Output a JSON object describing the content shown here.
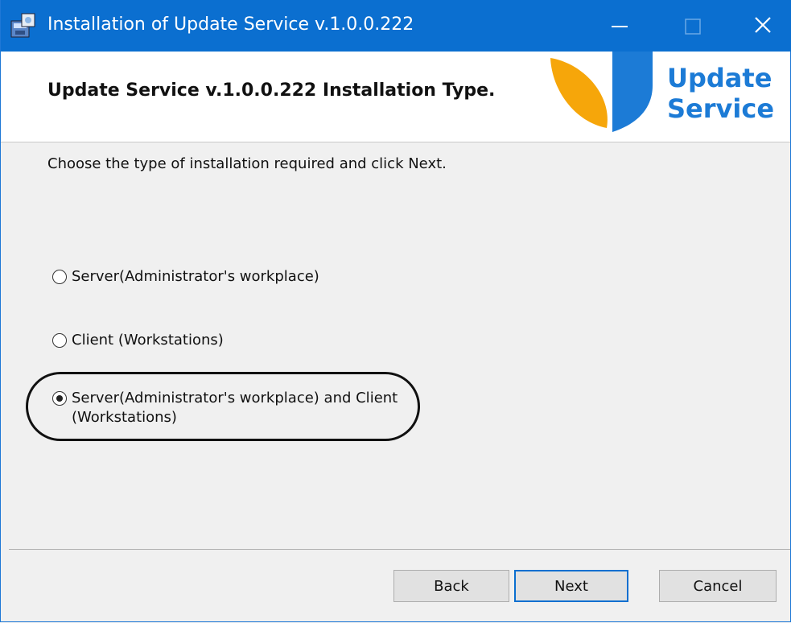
{
  "window": {
    "title": "Installation of Update Service v.1.0.0.222",
    "controls": {
      "minimize": "minimize",
      "maximize": "maximize",
      "close": "close"
    }
  },
  "header": {
    "title": "Update Service v.1.0.0.222 Installation Type.",
    "logo_line1": "Update",
    "logo_line2": "Service"
  },
  "body": {
    "instruction": "Choose the type of installation required and click Next.",
    "options": [
      {
        "label": "Server(Administrator's workplace)",
        "selected": false
      },
      {
        "label": "Client (Workstations)",
        "selected": false
      },
      {
        "label": "Server(Administrator's workplace) and Client (Workstations)",
        "selected": true
      }
    ]
  },
  "buttons": {
    "back": "Back",
    "next": "Next",
    "cancel": "Cancel"
  },
  "colors": {
    "titlebar": "#0b6fd0",
    "logo_blue": "#1c7bd6",
    "logo_orange": "#f6a60a"
  }
}
